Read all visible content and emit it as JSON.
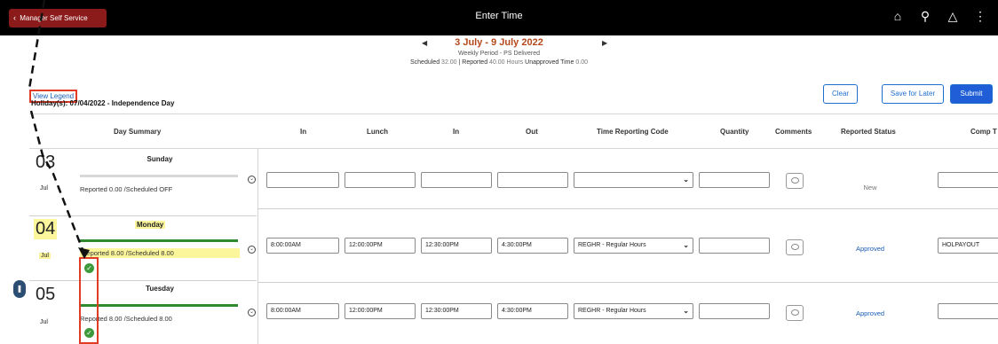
{
  "header": {
    "back_label": "Manager Self Service",
    "title": "Enter Time",
    "icons": [
      "home-icon",
      "search-icon",
      "bell-icon",
      "more-icon"
    ]
  },
  "period": {
    "range": "3 July - 9 July 2022",
    "type": "Weekly Period - PS Delivered",
    "scheduled_label": "Scheduled",
    "scheduled_value": "32.00",
    "reported_label": "Reported",
    "reported_value": "40.00 Hours",
    "unapproved_label": "Unapproved Time",
    "unapproved_value": "0.00"
  },
  "legend_link": "View Legend",
  "holiday": "Holiday(s): 07/04/2022 - Independence Day",
  "buttons": {
    "clear": "Clear",
    "save_later": "Save for Later",
    "submit": "Submit"
  },
  "columns": {
    "day_summary": "Day Summary",
    "in1": "In",
    "lunch": "Lunch",
    "in2": "In",
    "out": "Out",
    "trc": "Time Reporting Code",
    "quantity": "Quantity",
    "comments": "Comments",
    "status": "Reported Status",
    "comp": "Comp T"
  },
  "rows": [
    {
      "day": "03",
      "month": "Jul",
      "name": "Sunday",
      "summary": "Reported 0.00 /Scheduled OFF",
      "in1": "",
      "lunch": "",
      "in2": "",
      "out": "",
      "trc": "",
      "quantity": "",
      "status": "New",
      "comp": ""
    },
    {
      "day": "04",
      "month": "Jul",
      "name": "Monday",
      "summary": "Reported 8.00 /Scheduled 8.00",
      "in1": "8:00:00AM",
      "lunch": "12:00:00PM",
      "in2": "12:30:00PM",
      "out": "4:30:00PM",
      "trc": "REGHR - Regular Hours",
      "quantity": "",
      "status": "Approved",
      "comp": "HOLPAYOUT"
    },
    {
      "day": "05",
      "month": "Jul",
      "name": "Tuesday",
      "summary": "Reported 8.00 /Scheduled 8.00",
      "in1": "8:00:00AM",
      "lunch": "12:00:00PM",
      "in2": "12:30:00PM",
      "out": "4:30:00PM",
      "trc": "REGHR - Regular Hours",
      "quantity": "",
      "status": "Approved",
      "comp": ""
    }
  ],
  "colors": {
    "topbar": "#000000",
    "back_button": "#8b1a1a",
    "period_range": "#b5481a",
    "link": "#1a5eb7",
    "approved": "#1a5eb7",
    "highlight": "#fbf59b",
    "progress_green": "#2f8a2f",
    "annotation_red": "#e03b24"
  }
}
